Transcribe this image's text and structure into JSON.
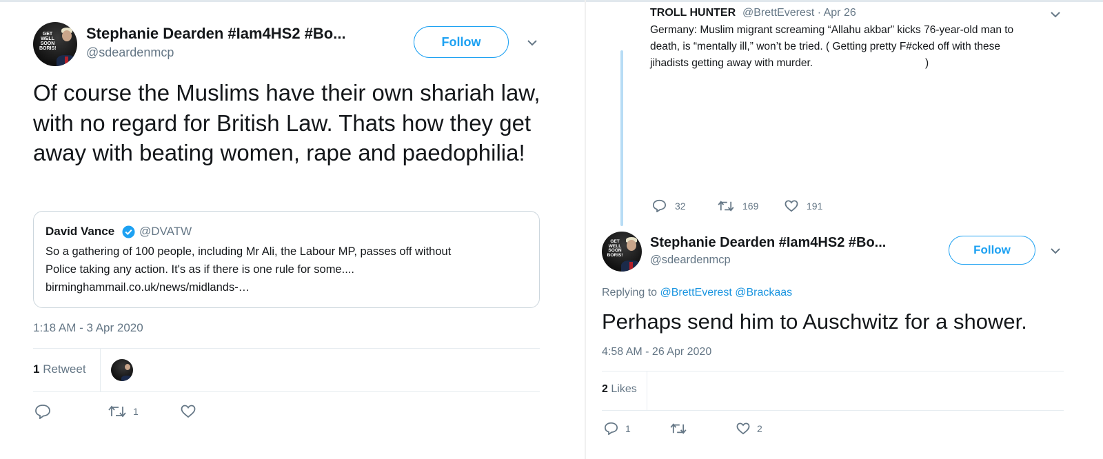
{
  "left": {
    "author_name": "Stephanie Dearden #Iam4HS2 #Bo...",
    "author_handle": "@sdeardenmcp",
    "avatar_text": "GET WELL SOON BORIS!",
    "follow_label": "Follow",
    "tweet_text": "Of course the Muslims have their own shariah law, with no regard for British Law. Thats how they get away with beating women, rape and paedophilia!",
    "quote": {
      "name": "David Vance",
      "handle": "@DVATW",
      "text_line1": "So a gathering of 100 people, including Mr Ali, the Labour MP, passes off without",
      "text_line2": "Police taking any action. It's as if there is one rule for some....",
      "text_line3": "birminghammail.co.uk/news/midlands-…"
    },
    "timestamp": "1:18 AM - 3 Apr 2020",
    "retweet_count": "1",
    "retweet_label": "Retweet",
    "actions": {
      "reply_count": "",
      "retweet_count": "1",
      "like_count": ""
    }
  },
  "right": {
    "parent": {
      "name": "TROLL HUNTER",
      "meta": "@BrettEverest · Apr 26",
      "text_line1": "Germany: Muslim migrant screaming “Allahu akbar” kicks 76-year-old man to",
      "text_line2": "death, is “mentally ill,” won’t be tried. ( Getting pretty F#cked off with these",
      "text_line3": "jihadists getting away with murder.",
      "text_close": ")",
      "reply_count": "32",
      "retweet_count": "169",
      "like_count": "191"
    },
    "author_name": "Stephanie Dearden #Iam4HS2 #Bo...",
    "author_handle": "@sdeardenmcp",
    "avatar_text": "GET WELL SOON BORIS!",
    "follow_label": "Follow",
    "replying_prefix": "Replying to",
    "replying_users": "@BrettEverest @Brackaas",
    "tweet_text": "Perhaps send him to Auschwitz for a shower.",
    "timestamp": "4:58 AM - 26 Apr 2020",
    "likes_count": "2",
    "likes_label": "Likes",
    "actions": {
      "reply_count": "1",
      "retweet_count": "",
      "like_count": "2"
    }
  },
  "colors": {
    "accent": "#1da1f2",
    "text": "#14171a",
    "muted": "#657786",
    "border": "#e6ecf0"
  }
}
